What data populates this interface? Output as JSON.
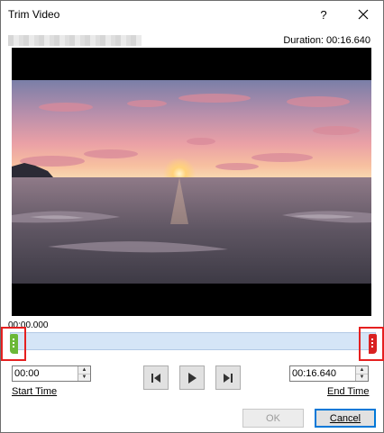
{
  "window": {
    "title": "Trim Video"
  },
  "title_buttons": {
    "help_label": "?",
    "close_icon": "close-icon"
  },
  "duration": "Duration: 00:16.640",
  "video": {
    "description_icon": "video-frame"
  },
  "scrubber": {
    "current_time": "00:00.000",
    "start_fraction": 0.0,
    "end_fraction": 1.0
  },
  "start_time": {
    "value": "00:00",
    "label": "Start Time"
  },
  "end_time": {
    "value": "00:16.640",
    "label": "End Time"
  },
  "playback": {
    "prev_icon": "previous-frame-icon",
    "play_icon": "play-icon",
    "next_icon": "next-frame-icon"
  },
  "buttons": {
    "ok_label": "OK",
    "cancel_label": "Cancel"
  },
  "colors": {
    "accent": "#0078d7",
    "start_marker": "#6bb838",
    "end_marker": "#d92121",
    "highlight": "#e52020"
  }
}
